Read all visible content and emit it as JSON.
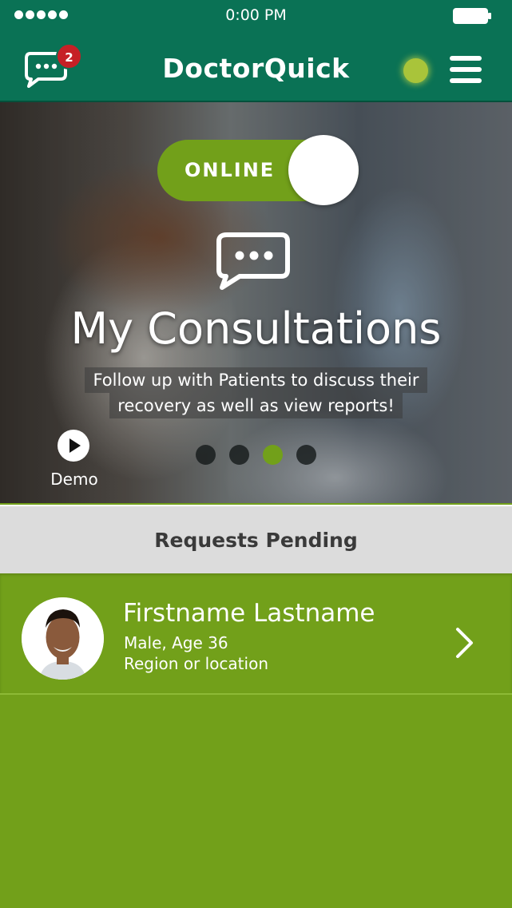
{
  "status_bar": {
    "time": "0:00 PM"
  },
  "nav": {
    "brand": "DoctorQuick",
    "message_badge": "2",
    "online_indicator_color": "#a9c43a"
  },
  "hero": {
    "toggle_label": "ONLINE",
    "title": "My Consultations",
    "subtitle_line1": "Follow up with Patients to discuss their",
    "subtitle_line2": "recovery as well as view reports!",
    "demo_label": "Demo",
    "carousel": {
      "count": 4,
      "active_index": 3
    }
  },
  "requests": {
    "header": "Requests Pending",
    "items": [
      {
        "name": "Firstname Lastname",
        "meta": "Male, Age 36",
        "location": "Region or location"
      }
    ]
  },
  "colors": {
    "primary_teal": "#0a7255",
    "accent_green": "#72a01a",
    "badge_red": "#c62026",
    "section_gray": "#dcdcdc"
  }
}
